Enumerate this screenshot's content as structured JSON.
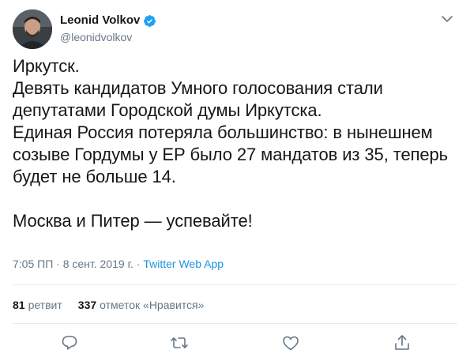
{
  "user": {
    "display_name": "Leonid Volkov",
    "handle": "@leonidvolkov",
    "verified_icon": "verified-badge-icon",
    "more_icon": "chevron-down-icon"
  },
  "tweet": {
    "lines": [
      "Иркутск.",
      "Девять кандидатов Умного голосования стали",
      "депутатами Городской думы Иркутска.",
      "Единая Россия потеряла большинство: в нынешнем",
      "созыве Гордумы у ЕР было 27 мандатов из 35, теперь",
      "будет не больше 14.",
      "Москва и Питер — успевайте!"
    ],
    "time": "7:05 ПП",
    "date": "8 сент. 2019 г.",
    "separator": "·",
    "source": "Twitter Web App"
  },
  "stats": {
    "retweets_count": "81",
    "retweets_label": "ретвит",
    "likes_count": "337",
    "likes_label": "отметок «Нравится»"
  },
  "actions": {
    "reply_icon": "reply-icon",
    "retweet_icon": "retweet-icon",
    "like_icon": "heart-icon",
    "share_icon": "share-icon"
  },
  "colors": {
    "text": "#14171a",
    "secondary": "#657786",
    "link": "#1b95e0",
    "verified": "#1da1f2",
    "divider": "#e6ecf0"
  }
}
